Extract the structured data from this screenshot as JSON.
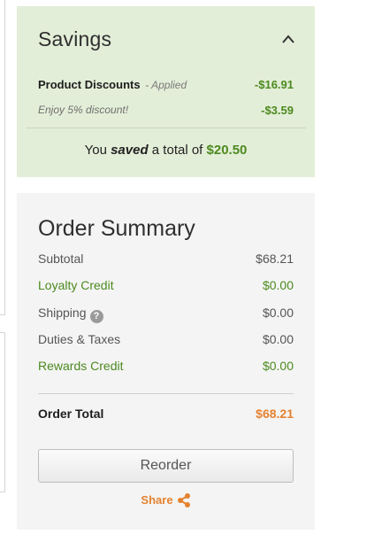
{
  "savings": {
    "title": "Savings",
    "product_discounts_label": "Product Discounts",
    "product_discounts_status": "- Applied",
    "product_discounts_value": "-$16.91",
    "promo_label": "Enjoy 5% discount!",
    "promo_value": "-$3.59",
    "total_prefix": "You",
    "total_em": "saved",
    "total_mid": "a total of",
    "total_amount": "$20.50"
  },
  "summary": {
    "title": "Order Summary",
    "rows": [
      {
        "label": "Subtotal",
        "value": "$68.21"
      },
      {
        "label": "Loyalty Credit",
        "value": "$0.00"
      },
      {
        "label": "Shipping",
        "value": "$0.00"
      },
      {
        "label": "Duties & Taxes",
        "value": "$0.00"
      },
      {
        "label": "Rewards Credit",
        "value": "$0.00"
      }
    ],
    "help_glyph": "?",
    "order_total_label": "Order Total",
    "order_total_value": "$68.21",
    "reorder_label": "Reorder",
    "share_label": "Share"
  },
  "icons": {
    "collapse": "chevron-up-icon",
    "help": "help-icon",
    "share": "share-icon"
  },
  "colors": {
    "savings_bg": "#e3eed8",
    "summary_bg": "#f4f4f4",
    "green": "#4c8a1f",
    "orange": "#e5822f"
  }
}
